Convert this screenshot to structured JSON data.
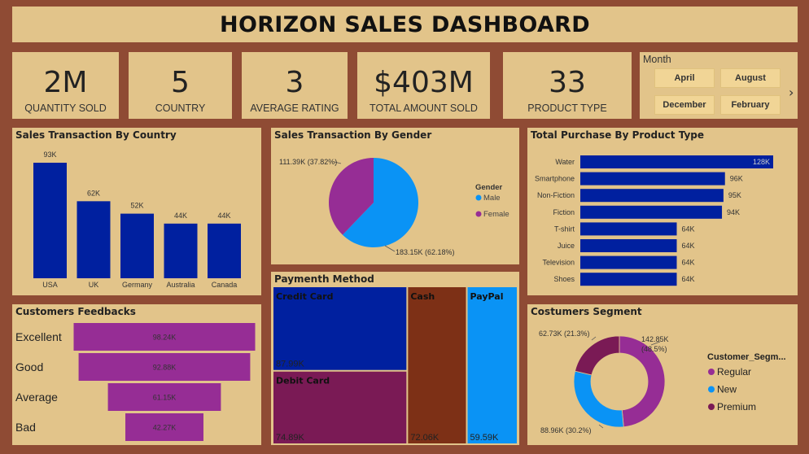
{
  "title": "HORIZON SALES DASHBOARD",
  "kpis": [
    {
      "value": "2M",
      "label": "QUANTITY SOLD"
    },
    {
      "value": "5",
      "label": "COUNTRY"
    },
    {
      "value": "3",
      "label": "AVERAGE RATING"
    },
    {
      "value": "$403M",
      "label": "TOTAL AMOUNT SOLD"
    },
    {
      "value": "33",
      "label": "PRODUCT TYPE"
    }
  ],
  "month_slicer": {
    "label": "Month",
    "options": [
      "April",
      "August",
      "December",
      "February"
    ],
    "next_icon": "chevron-right-icon"
  },
  "colors": {
    "background": "#8f4b34",
    "panel": "#e2c48a",
    "navy": "#00209f",
    "purple": "#962d95",
    "blue": "#0a93f5",
    "maroon": "#7a1a55",
    "brown": "#7d3016",
    "funnel": "#962d95"
  },
  "chart_data": [
    {
      "type": "bar",
      "title": "Sales Transaction By Country",
      "categories": [
        "USA",
        "UK",
        "Germany",
        "Australia",
        "Canada"
      ],
      "values": [
        93,
        62,
        52,
        44,
        44
      ],
      "value_labels": [
        "93K",
        "62K",
        "52K",
        "44K",
        "44K"
      ],
      "ylim": [
        0,
        100
      ]
    },
    {
      "type": "pie",
      "title": "Sales Transaction By Gender",
      "legend_title": "Gender",
      "legend_position": "right",
      "slices": [
        {
          "name": "Male",
          "value": 183.15,
          "percent": 62.18,
          "label": "183.15K (62.18%)"
        },
        {
          "name": "Female",
          "value": 111.39,
          "percent": 37.82,
          "label": "111.39K (37.82%)"
        }
      ]
    },
    {
      "type": "bar",
      "orientation": "horizontal",
      "title": "Total Purchase By Product Type",
      "categories": [
        "Water",
        "Smartphone",
        "Non-Fiction",
        "Fiction",
        "T-shirt",
        "Juice",
        "Television",
        "Shoes"
      ],
      "values": [
        128,
        96,
        95,
        94,
        64,
        64,
        64,
        64
      ],
      "value_labels": [
        "128K",
        "96K",
        "95K",
        "94K",
        "64K",
        "64K",
        "64K",
        "64K"
      ],
      "xlim": [
        0,
        128
      ]
    },
    {
      "type": "funnel",
      "title": "Customers Feedbacks",
      "categories": [
        "Excellent",
        "Good",
        "Average",
        "Bad"
      ],
      "values": [
        98.24,
        92.88,
        61.15,
        42.27
      ],
      "value_labels": [
        "98.24K",
        "92.88K",
        "61.15K",
        "42.27K"
      ]
    },
    {
      "type": "treemap",
      "title": "Paymenth Method",
      "items": [
        {
          "name": "Credit Card",
          "value": 87.99,
          "label": "87.99K"
        },
        {
          "name": "Debit Card",
          "value": 74.89,
          "label": "74.89K"
        },
        {
          "name": "Cash",
          "value": 72.06,
          "label": "72.06K"
        },
        {
          "name": "PayPal",
          "value": 59.59,
          "label": "59.59K"
        }
      ]
    },
    {
      "type": "pie",
      "donut": true,
      "title": "Costumers Segment",
      "legend_title": "Customer_Segm...",
      "legend_position": "right",
      "slices": [
        {
          "name": "Regular",
          "value": 142.85,
          "percent": 48.5,
          "label": "142.85K",
          "pct_label": "(48.5%)"
        },
        {
          "name": "New",
          "value": 88.96,
          "percent": 30.2,
          "label": "88.96K (30.2%)"
        },
        {
          "name": "Premium",
          "value": 62.73,
          "percent": 21.3,
          "label": "62.73K (21.3%)"
        }
      ]
    }
  ]
}
